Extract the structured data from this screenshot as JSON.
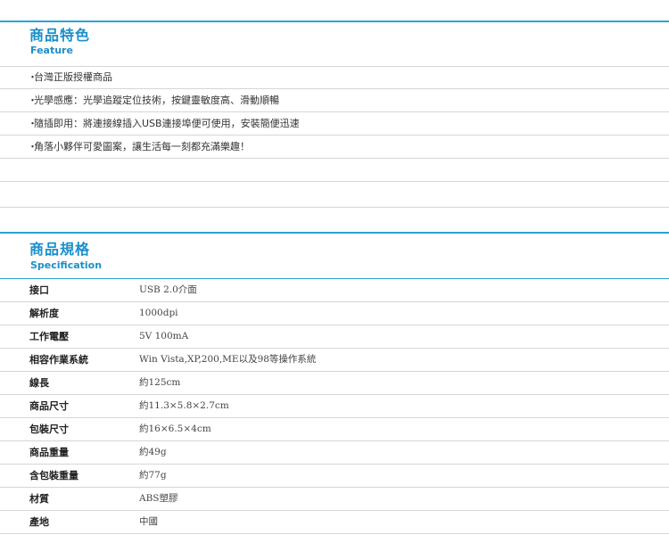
{
  "feature": {
    "title": "商品特色",
    "subtitle": "Feature",
    "bullet": "・",
    "items": [
      "台灣正版授權商品",
      "光學感應：光學追蹤定位技術，按鍵靈敏度高、滑動順暢",
      "隨插即用：將連接線插入USB連接埠便可使用，安裝簡便迅速",
      "角落小夥伴可愛圖案，讓生活每一刻都充滿樂趣！",
      "",
      "",
      ""
    ]
  },
  "spec": {
    "title": "商品規格",
    "subtitle": "Specification",
    "rows": [
      {
        "key": "接口",
        "value": "USB 2.0介面"
      },
      {
        "key": "解析度",
        "value": "1000dpi"
      },
      {
        "key": "工作電壓",
        "value": "5V 100mA"
      },
      {
        "key": "相容作業系統",
        "value": "Win Vista,XP,200,ME以及98等操作系統"
      },
      {
        "key": "線長",
        "value": "約125cm"
      },
      {
        "key": "商品尺寸",
        "value": "約11.3×5.8×2.7cm"
      },
      {
        "key": "包裝尺寸",
        "value": "約16×6.5×4cm"
      },
      {
        "key": "商品重量",
        "value": "約49g"
      },
      {
        "key": "含包裝重量",
        "value": "約77g"
      },
      {
        "key": "材質",
        "value": "ABS塑膠"
      },
      {
        "key": "產地",
        "value": "中國"
      }
    ]
  },
  "colors": {
    "accent": "#1a8fc9",
    "divider": "#d6d6d6"
  }
}
